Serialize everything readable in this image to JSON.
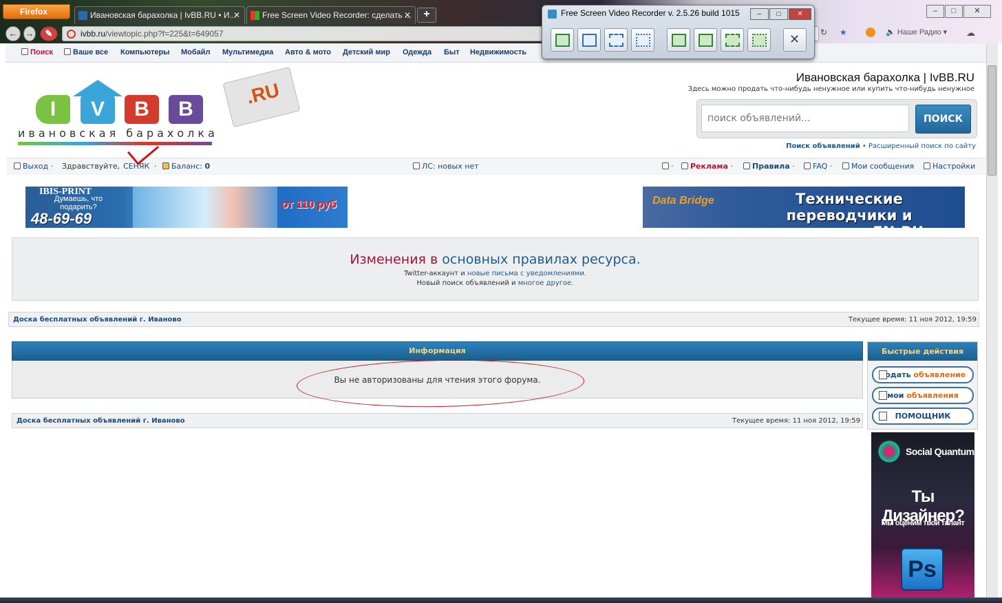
{
  "browser": {
    "firefox_label": "Firefox",
    "tabs": [
      {
        "title": "Ивановская барахолка | IvBB.RU • И..."
      },
      {
        "title": "Free Screen Video Recorder: сделать ..."
      }
    ],
    "new_tab": "+",
    "url_domain": "ivbb.ru",
    "url_path": "/viewtopic.php?f=225&t=649057",
    "radio_label": "Наше Радио",
    "window_controls": [
      "–",
      "□",
      "✕"
    ]
  },
  "recorder": {
    "title": "Free Screen Video Recorder  v. 2.5.26 build 1015",
    "controls": [
      "–",
      "□",
      "✕"
    ],
    "buttons": [
      "full-screen-capture",
      "window-capture",
      "region-capture",
      "freehand-capture",
      "full-screen-video",
      "window-video",
      "region-video",
      "freehand-video",
      "options"
    ]
  },
  "site_nav": {
    "items": [
      "Поиск",
      "Ваше все",
      "Компьютеры",
      "Мобайл",
      "Мультимедиа",
      "Авто & мото",
      "Детский мир",
      "Одежда",
      "Быт",
      "Недвижимость"
    ]
  },
  "logo": {
    "letters": [
      "I",
      "V",
      "B",
      "B"
    ],
    "tagline": "ивановская барахолка",
    "tag": ".RU"
  },
  "header": {
    "title": "Ивановская барахолка | IvBB.RU",
    "subtitle": "Здесь можно продать что-нибудь ненужное или купить что-нибудь ненужное",
    "search_placeholder": "поиск объявлений...",
    "search_button": "ПОИСК",
    "link_search": "Поиск объявлений",
    "link_sep": " • ",
    "link_advanced": "Расширенный поиск по сайту"
  },
  "userbar": {
    "logout": "Выход",
    "greeting": "Здравствуйте,",
    "username": "СЕНЯК",
    "balance_label": "Баланс:",
    "balance_value": "0",
    "pm": "ЛС: новых нет",
    "ads": "Реклама",
    "rules": "Правила",
    "faq": "FAQ",
    "my_messages": "Мои сообщения",
    "settings": "Настройки"
  },
  "banner_left": {
    "brand": "IBIS-PRINT",
    "question": "Думаешь, что подарить?",
    "phone": "48-69-69",
    "price": "от 110 руб"
  },
  "banner_right": {
    "brand": "Data Bridge",
    "text": "Технические переводчики и редакторы EN-RU"
  },
  "announcement": {
    "title_red": "Изменения в",
    "title_blue": "основных правилах ресурса.",
    "line1_a": "Twitter-аккаунт и",
    "line1_b": "новые письма с уведомлениями.",
    "line2_a": "Новый поиск объявлений и",
    "line2_b": "многое другое."
  },
  "crumbs": {
    "board": "Доска бесплатных объявлений г. Иваново",
    "time": "Текущее время: 11 ноя 2012, 19:59"
  },
  "info": {
    "heading": "Информация",
    "message": "Вы не авторизованы для чтения этого форума."
  },
  "quick": {
    "heading": "Быстрые действия",
    "btn1_a": "подать",
    "btn1_b": "объявление",
    "btn2_a": "мои",
    "btn2_b": "объявления",
    "btn3": "ПОМОЩНИК"
  },
  "ad_side": {
    "brand": "Social Quantum",
    "headline": "Ты Дизайнер?",
    "sub": "Мы оценим твой талант",
    "app": "Ps"
  },
  "colors": {
    "brand_blue": "#1c5f8f",
    "accent_orange": "#e06a12",
    "alert_red": "#a3103a",
    "annotation_red": "#d0121a"
  }
}
